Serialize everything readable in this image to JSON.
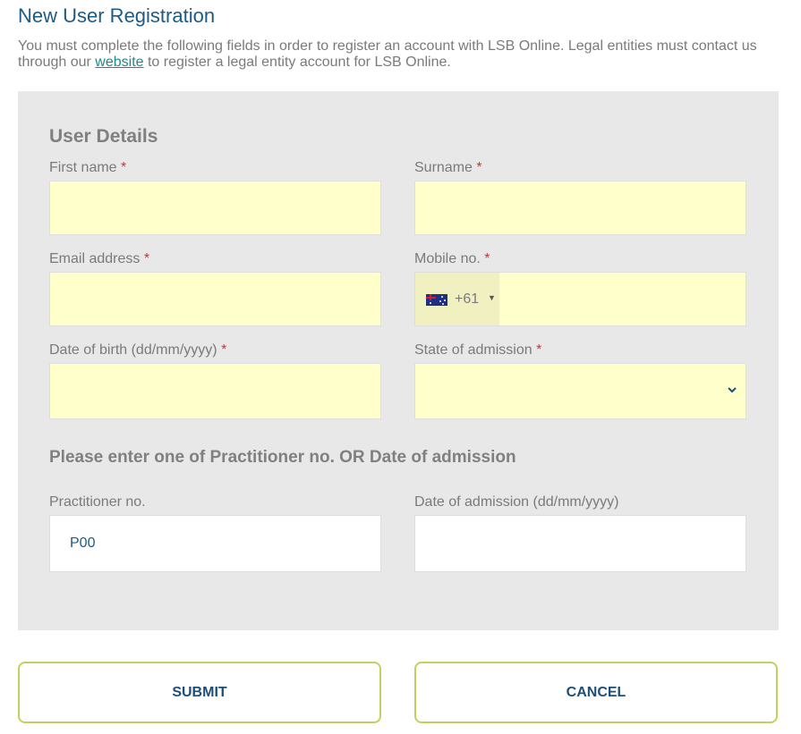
{
  "page": {
    "title": "New User Registration",
    "intro_before_link": "You must complete the following fields in order to register an account with LSB Online. Legal entities must contact us through our ",
    "intro_link": "website",
    "intro_after_link": " to register a legal entity account for LSB Online."
  },
  "form": {
    "section_title": "User Details",
    "first_name_label": "First name",
    "surname_label": "Surname",
    "email_label": "Email address",
    "mobile_label": "Mobile no.",
    "mobile_country_code": "+61",
    "dob_label": "Date of birth (dd/mm/yyyy)",
    "state_label": "State of admission",
    "required_marker": "*",
    "alt_section_title": "Please enter one of Practitioner no. OR Date of admission",
    "practitioner_label": "Practitioner no.",
    "practitioner_value": "P00",
    "admission_date_label": "Date of admission (dd/mm/yyyy)"
  },
  "buttons": {
    "submit": "SUBMIT",
    "cancel": "CANCEL"
  },
  "icons": {
    "flag": "australia-flag-icon",
    "caret": "caret-down-icon",
    "chevron": "chevron-down-icon"
  },
  "colors": {
    "required_field_bg": "#ffffcc",
    "panel_bg": "#e8e8e8",
    "title": "#1d5a85",
    "button_border": "#bcd35f",
    "required_marker": "#e02b2b"
  }
}
